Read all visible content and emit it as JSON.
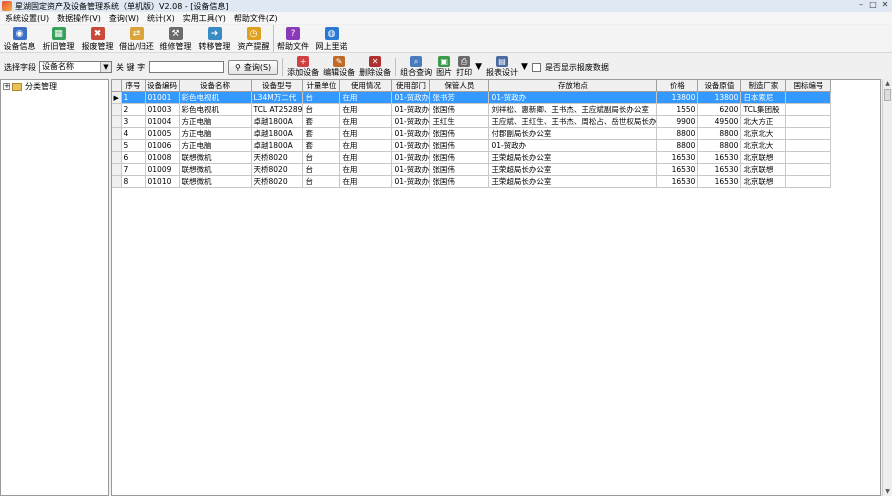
{
  "window": {
    "title": "星湖固定资产及设备管理系统（单机版）V2.08 - [设备信息]",
    "minimize": "–",
    "maximize": "□",
    "close": "✕"
  },
  "menu": [
    "系统设置(U)",
    "数据操作(V)",
    "查询(W)",
    "统计(X)",
    "实用工具(Y)",
    "帮助文件(Z)"
  ],
  "toolbar_main": [
    {
      "label": "设备信息",
      "icon": "device-info-icon",
      "color": "#3a6fc4",
      "glyph": "◉"
    },
    {
      "label": "折旧管理",
      "icon": "depreciation-icon",
      "color": "#3aa15a",
      "glyph": "▦"
    },
    {
      "label": "报废管理",
      "icon": "scrap-icon",
      "color": "#c94a3a",
      "glyph": "✖"
    },
    {
      "label": "借出/归还",
      "icon": "lend-return-icon",
      "color": "#d9a53a",
      "glyph": "⇄"
    },
    {
      "label": "维修管理",
      "icon": "repair-icon",
      "color": "#6b6b6b",
      "glyph": "⚒"
    },
    {
      "label": "转移管理",
      "icon": "transfer-icon",
      "color": "#3a8ac4",
      "glyph": "➜"
    },
    {
      "label": "资产提醒",
      "icon": "alarm-clock-icon",
      "color": "#e0a020",
      "glyph": "◷"
    },
    {
      "label": "帮助文件",
      "icon": "help-book-icon",
      "color": "#8a3ab8",
      "glyph": "?"
    },
    {
      "label": "网上里诺",
      "icon": "globe-icon",
      "color": "#2a7ad4",
      "glyph": "◍"
    }
  ],
  "search": {
    "field_label": "选择字段",
    "field_value": "设备名称",
    "keyword_label": "关 键 字",
    "keyword_value": "",
    "query_button": "查询(S)"
  },
  "toolbar_actions": [
    {
      "label": "添加设备",
      "icon": "add-device-icon",
      "color": "#d04040",
      "glyph": "+"
    },
    {
      "label": "编辑设备",
      "icon": "edit-device-icon",
      "color": "#c06a2a",
      "glyph": "✎"
    },
    {
      "label": "删除设备",
      "icon": "delete-device-icon",
      "color": "#b03030",
      "glyph": "✕"
    },
    {
      "label": "组合查询",
      "icon": "combined-query-icon",
      "color": "#4a7ac0",
      "glyph": "⌕"
    },
    {
      "label": "图片",
      "icon": "picture-icon",
      "color": "#3a9a4a",
      "glyph": "▣"
    },
    {
      "label": "打印",
      "icon": "printer-icon",
      "color": "#6a6a6a",
      "glyph": "⎙"
    },
    {
      "label": "报表设计",
      "icon": "report-design-icon",
      "color": "#4a6aa0",
      "glyph": "▤"
    }
  ],
  "show_scrapped_label": "是否显示报废数据",
  "tree": {
    "root_label": "分类管理",
    "expander": "+"
  },
  "grid": {
    "columns": [
      "序号",
      "设备编码",
      "设备名称",
      "设备型号",
      "计量单位",
      "使用情况",
      "使用部门",
      "保管人员",
      "存放地点",
      "价格",
      "设备原值",
      "制造厂家",
      "国标编号"
    ],
    "rows": [
      [
        "1",
        "01001",
        "彩色电视机",
        "L34M万二代",
        "台",
        "在用",
        "01-贸政办",
        "张书芳",
        "01-贸政办",
        "13800",
        "13800",
        "日本索尼",
        ""
      ],
      [
        "2",
        "01003",
        "彩色电视机",
        "TCL AT25289",
        "台",
        "在用",
        "01-贸政办",
        "张国伟",
        "刘祥松、惠新卿、王书杰、王应斌副局长办公室",
        "1550",
        "6200",
        "TCL集团股",
        ""
      ],
      [
        "3",
        "01004",
        "方正电脑",
        "卓越1800A",
        "套",
        "在用",
        "01-贸政办",
        "王红生",
        "王应斌、王红生、王书杰、周松占、岳世权局长办",
        "9900",
        "49500",
        "北大方正",
        ""
      ],
      [
        "4",
        "01005",
        "方正电脑",
        "卓越1800A",
        "套",
        "在用",
        "01-贸政办",
        "张国伟",
        "付郡副局长办公室",
        "8800",
        "8800",
        "北京北大",
        ""
      ],
      [
        "5",
        "01006",
        "方正电脑",
        "卓越1800A",
        "套",
        "在用",
        "01-贸政办",
        "张国伟",
        "01-贸政办",
        "8800",
        "8800",
        "北京北大",
        ""
      ],
      [
        "6",
        "01008",
        "联想微机",
        "天桥8020",
        "台",
        "在用",
        "01-贸政办",
        "张国伟",
        "王荣超局长办公室",
        "16530",
        "16530",
        "北京联想",
        ""
      ],
      [
        "7",
        "01009",
        "联想微机",
        "天桥8020",
        "台",
        "在用",
        "01-贸政办",
        "张国伟",
        "王荣超局长办公室",
        "16530",
        "16530",
        "北京联想",
        ""
      ],
      [
        "8",
        "01010",
        "联想微机",
        "天桥8020",
        "台",
        "在用",
        "01-贸政办",
        "张国伟",
        "王荣超局长办公室",
        "16530",
        "16530",
        "北京联想",
        ""
      ]
    ],
    "selected_row": 0,
    "row_pointer": "▶"
  }
}
